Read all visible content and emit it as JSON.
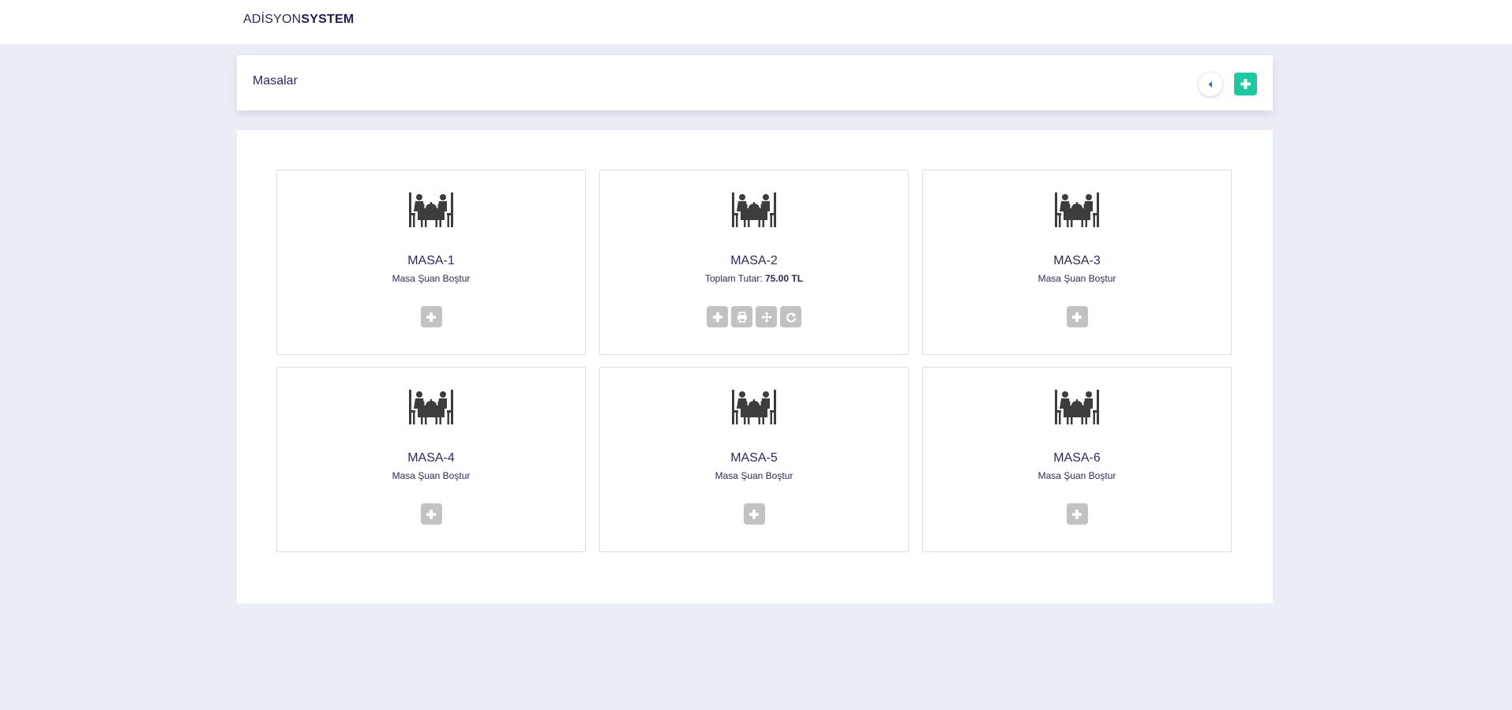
{
  "brand": {
    "light": "ADİSYON",
    "bold": "SYSTEM"
  },
  "header": {
    "title": "Masalar"
  },
  "tables": [
    {
      "name": "MASA-1",
      "status_text": "Masa Şuan Boştur",
      "total_label": "",
      "total_value": "",
      "actions": [
        "plus-icon"
      ]
    },
    {
      "name": "MASA-2",
      "status_text": "",
      "total_label": "Toplam Tutar:",
      "total_value": "75.00 TL",
      "actions": [
        "plus-icon",
        "print-icon",
        "move-icon",
        "redo-icon"
      ]
    },
    {
      "name": "MASA-3",
      "status_text": "Masa Şuan Boştur",
      "total_label": "",
      "total_value": "",
      "actions": [
        "plus-icon"
      ]
    },
    {
      "name": "MASA-4",
      "status_text": "Masa Şuan Boştur",
      "total_label": "",
      "total_value": "",
      "actions": [
        "plus-icon"
      ]
    },
    {
      "name": "MASA-5",
      "status_text": "Masa Şuan Boştur",
      "total_label": "",
      "total_value": "",
      "actions": [
        "plus-icon"
      ]
    },
    {
      "name": "MASA-6",
      "status_text": "Masa Şuan Boştur",
      "total_label": "",
      "total_value": "",
      "actions": [
        "plus-icon"
      ]
    }
  ],
  "colors": {
    "background": "#eaedf6",
    "text": "#2b2a5e",
    "accent": "#1ec8a0",
    "back_arrow": "#2f6bd8",
    "action_button": "#c2c2c2",
    "table_icon": "#3d3d3d"
  }
}
